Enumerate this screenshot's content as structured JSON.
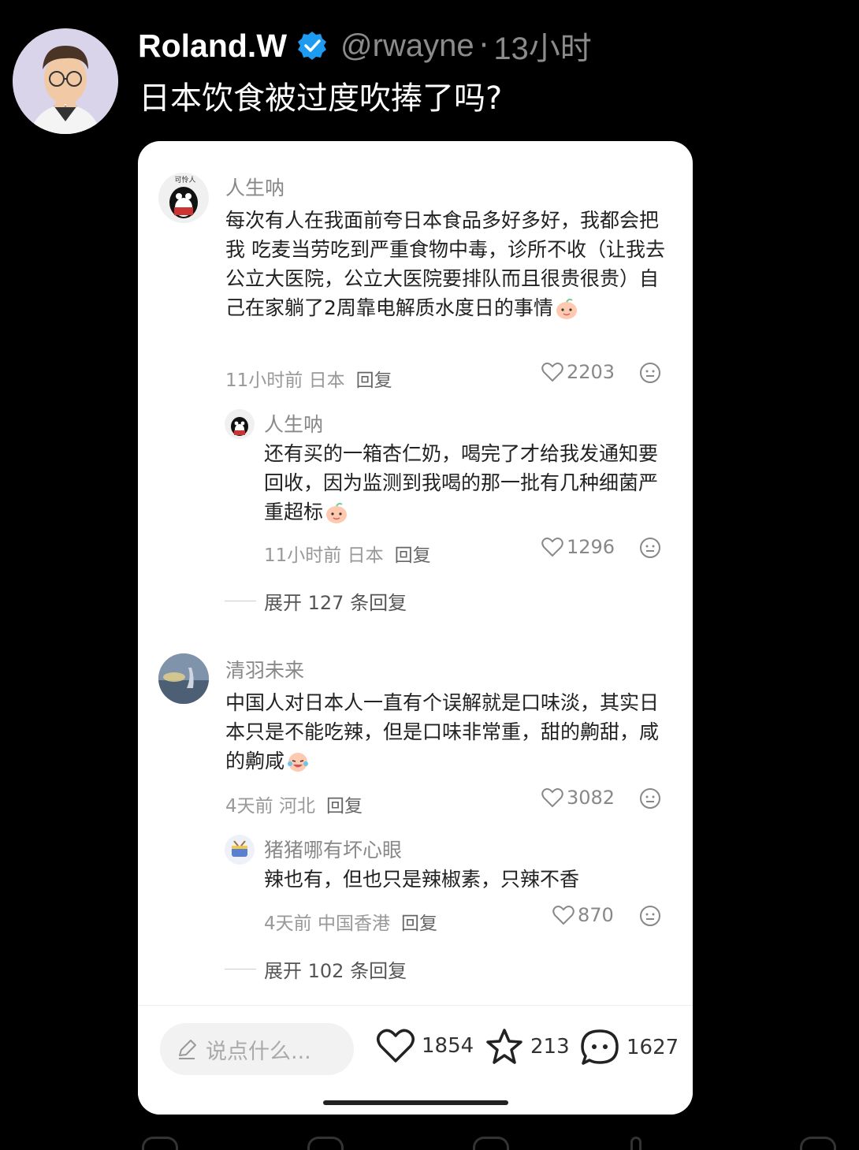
{
  "tweet": {
    "author_name": "Roland.W",
    "handle": "@rwayne",
    "separator": "·",
    "time": "13小时",
    "text": "日本饮食被过度吹捧了吗?"
  },
  "card": {
    "comments": [
      {
        "user": "人生呐",
        "avatar_label": "可怜人",
        "text": "每次有人在我面前夸日本食品多好多好，我都会把我 吃麦当劳吃到严重食物中毒，诊所不收（让我去公立大医院，公立大医院要排队而且很贵很贵）自己在家躺了2周靠电解质水度日的事情",
        "time": "11小时前",
        "location": "日本",
        "reply_label": "回复",
        "likes": "2203",
        "replies": [
          {
            "user": "人生呐",
            "text": "还有买的一箱杏仁奶，喝完了才给我发通知要回收，因为监测到我喝的那一批有几种细菌严重超标",
            "time": "11小时前",
            "location": "日本",
            "reply_label": "回复",
            "likes": "1296"
          }
        ],
        "expand_label": "展开 127 条回复"
      },
      {
        "user": "清羽未来",
        "text": "中国人对日本人一直有个误解就是口味淡，其实日本只是不能吃辣，但是口味非常重，甜的齁甜，咸的齁咸",
        "time": "4天前",
        "location": "河北",
        "reply_label": "回复",
        "likes": "3082",
        "replies": [
          {
            "user": "猪猪哪有坏心眼",
            "text": "辣也有，但也只是辣椒素，只辣不香",
            "time": "4天前",
            "location": "中国香港",
            "reply_label": "回复",
            "likes": "870"
          }
        ],
        "expand_label": "展开 102 条回复"
      }
    ],
    "bottom_bar": {
      "input_placeholder": "说点什么...",
      "likes": "1854",
      "favorites": "213",
      "comments": "1627"
    }
  },
  "colors": {
    "background": "#000000",
    "verified_badge": "#1d9bf0",
    "card_bg": "#ffffff",
    "muted_text": "#8b8b8b"
  }
}
